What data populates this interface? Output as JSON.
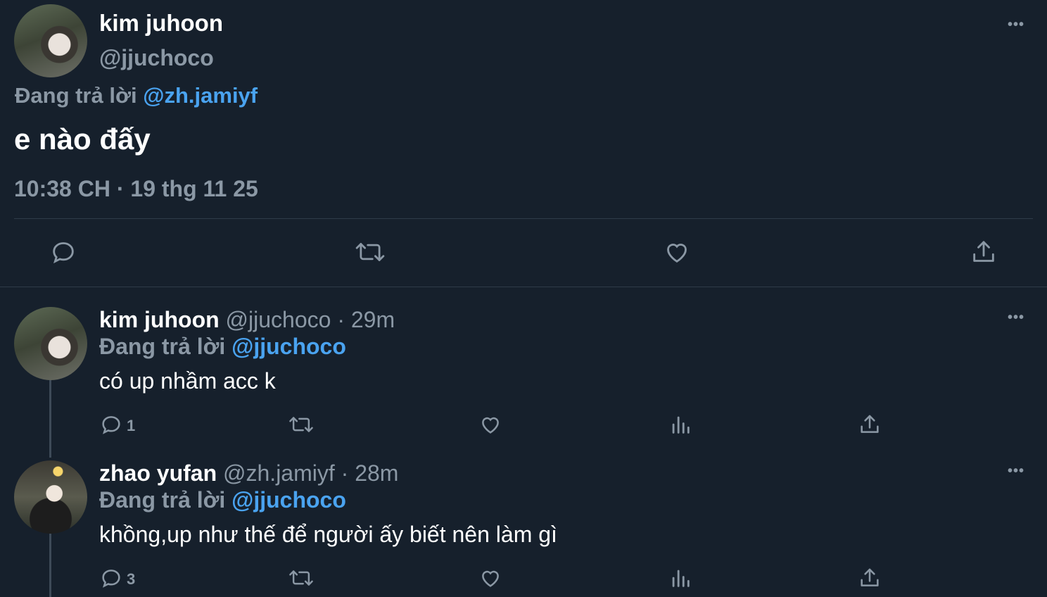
{
  "main_tweet": {
    "display_name": "kim juhoon",
    "handle": "@jjuchoco",
    "replying_prefix": "Đang trả lời",
    "replying_to": "@zh.jamiyf",
    "text": "e nào đấy",
    "timestamp": "10:38 CH · 19 thg 11 25",
    "more": "•••"
  },
  "replies": [
    {
      "display_name": "kim juhoon",
      "handle": "@jjuchoco",
      "age": "· 29m",
      "replying_prefix": "Đang trả lời",
      "replying_to": "@jjuchoco",
      "text": "có up nhầm acc k",
      "reply_count": "1",
      "more": "•••"
    },
    {
      "display_name": "zhao yufan",
      "handle": "@zh.jamiyf",
      "age": "· 28m",
      "replying_prefix": "Đang trả lời",
      "replying_to": "@jjuchoco",
      "text": "khồng,up như thế để người ấy biết nên làm gì",
      "reply_count": "3",
      "more": "•••"
    }
  ],
  "icons": {
    "reply": "reply-icon",
    "retweet": "retweet-icon",
    "like": "heart-icon",
    "views": "analytics-icon",
    "share": "share-icon"
  },
  "colors": {
    "background": "#16202c",
    "link": "#4aa3f0",
    "muted": "#8b98a5",
    "divider": "#2f3b49"
  }
}
